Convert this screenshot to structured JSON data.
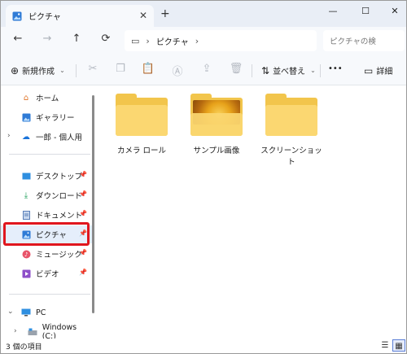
{
  "window": {
    "tab_title": "ピクチャ",
    "tab_close": "✕",
    "new_tab": "+",
    "minimize": "—",
    "maximize": "☐",
    "close": "✕"
  },
  "nav": {
    "back": "←",
    "forward": "→",
    "up": "↑",
    "refresh": "⟳",
    "address_icon": "▭",
    "breadcrumb": [
      "ピクチャ"
    ],
    "chevron": "›",
    "search_placeholder": "ピクチャの検"
  },
  "toolbar": {
    "new_label": "新規作成",
    "sort_label": "並べ替え",
    "more_label": "•••",
    "details_label": "詳細"
  },
  "sidebar": {
    "items": [
      {
        "label": "ホーム",
        "icon": "home-icon"
      },
      {
        "label": "ギャラリー",
        "icon": "gallery-icon"
      },
      {
        "label": "一郎 - 個人用",
        "icon": "onedrive-icon"
      },
      {
        "label": "デスクトップ",
        "icon": "desktop-icon"
      },
      {
        "label": "ダウンロード",
        "icon": "download-icon"
      },
      {
        "label": "ドキュメント",
        "icon": "documents-icon"
      },
      {
        "label": "ピクチャ",
        "icon": "pictures-icon"
      },
      {
        "label": "ミュージック",
        "icon": "music-icon"
      },
      {
        "label": "ビデオ",
        "icon": "video-icon"
      },
      {
        "label": "PC",
        "icon": "pc-icon"
      },
      {
        "label": "Windows (C:)",
        "icon": "drive-icon"
      }
    ]
  },
  "content": {
    "folders": [
      {
        "label": "カメラ ロール"
      },
      {
        "label": "サンプル画像"
      },
      {
        "label": "スクリーンショット"
      }
    ]
  },
  "status": {
    "item_count": "3 個の項目"
  },
  "colors": {
    "highlight": "#e0161e",
    "folder": "#f2c54c",
    "selected_bg": "#e5eefb"
  }
}
